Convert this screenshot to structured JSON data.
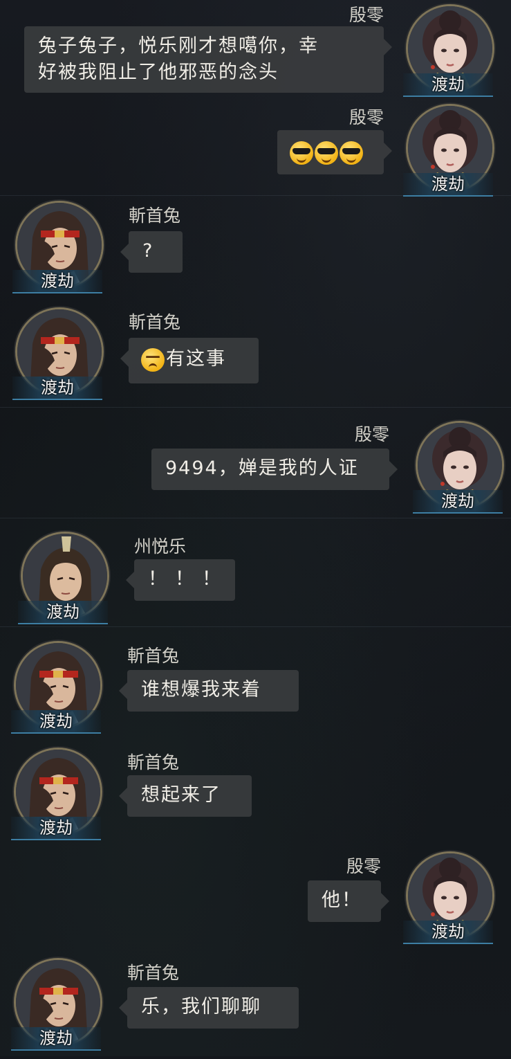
{
  "chat": {
    "messages": [
      {
        "sender": "殷零",
        "title": "渡劫",
        "side": "right",
        "portrait": "female-portrait",
        "text": "兔子兔子，悦乐刚才想噶你，幸",
        "text2": "好被我阻止了他邪恶的念头"
      },
      {
        "sender": "殷零",
        "title": "渡劫",
        "side": "right",
        "portrait": "female-portrait",
        "emojis": [
          "cool-emoji",
          "cool-emoji",
          "cool-emoji"
        ]
      },
      {
        "sender": "斬首兔",
        "title": "渡劫",
        "side": "left",
        "portrait": "headband-male-portrait",
        "text": "?"
      },
      {
        "sender": "斬首兔",
        "title": "渡劫",
        "side": "left",
        "portrait": "headband-male-portrait",
        "emoji": "angry-emoji",
        "text": "有这事"
      },
      {
        "sender": "殷零",
        "title": "渡劫",
        "side": "right",
        "portrait": "female-portrait",
        "text": "9494，婵是我的人证"
      },
      {
        "sender": "州悦乐",
        "title": "渡劫",
        "side": "left",
        "portrait": "topknot-male-portrait",
        "text": "！！！"
      },
      {
        "sender": "斬首兔",
        "title": "渡劫",
        "side": "left",
        "portrait": "headband-male-portrait",
        "text": "谁想爆我来着"
      },
      {
        "sender": "斬首兔",
        "title": "渡劫",
        "side": "left",
        "portrait": "headband-male-portrait",
        "text": "想起来了"
      },
      {
        "sender": "殷零",
        "title": "渡劫",
        "side": "right",
        "portrait": "female-portrait",
        "text": "他！"
      },
      {
        "sender": "斬首兔",
        "title": "渡劫",
        "side": "left",
        "portrait": "headband-male-portrait",
        "text": "乐，我们聊聊"
      }
    ]
  },
  "colors": {
    "background": "#14171c",
    "bubble": "#3a3c3e",
    "name_text": "#d2d0c8",
    "message_text": "#f0ede6",
    "ribbon_accent": "#3d7ea3",
    "avatar_frame": "#7e7458"
  }
}
